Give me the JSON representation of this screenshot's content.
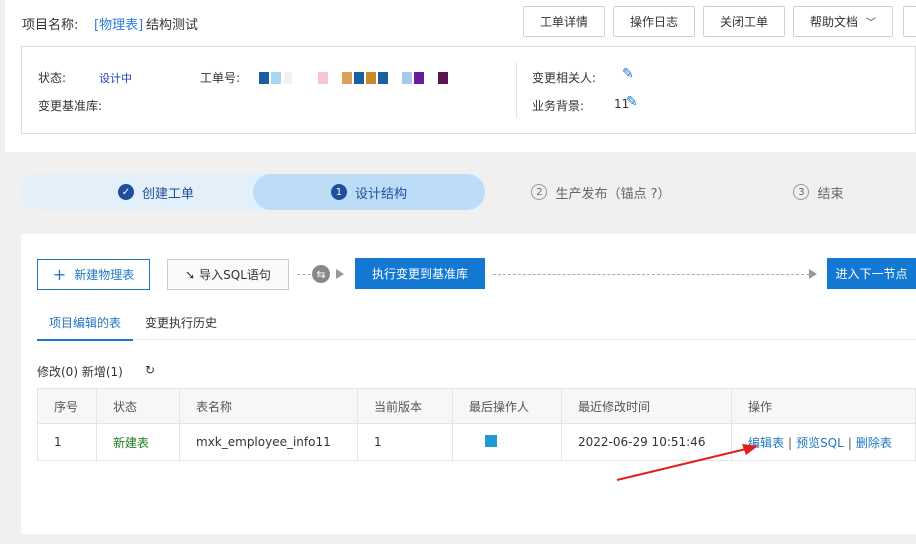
{
  "header": {
    "project_label": "项目名称:",
    "project_link": "[物理表]",
    "project_name": "结构测试",
    "buttons": [
      "工单详情",
      "操作日志",
      "关闭工单",
      "帮助文档"
    ]
  },
  "info": {
    "status_label": "状态:",
    "status_value": "设计中",
    "ticket_label": "工单号:",
    "base_label": "变更基准库:",
    "people_label": "变更相关人:",
    "background_label": "业务背景:",
    "background_value": "11"
  },
  "steps": [
    {
      "label": "创建工单",
      "marker": "✓"
    },
    {
      "label": "设计结构",
      "marker": "1"
    },
    {
      "label": "生产发布（锚点 ?）",
      "marker": "2"
    },
    {
      "label": "结束",
      "marker": "3"
    }
  ],
  "toolbar": {
    "new_table": "新建物理表",
    "import_sql": "导入SQL语句",
    "execute": "执行变更到基准库",
    "next_node": "进入下一节点"
  },
  "tabs": [
    "项目编辑的表",
    "变更执行历史"
  ],
  "stats": {
    "text": "修改(0)  新增(1)"
  },
  "table": {
    "headers": [
      "序号",
      "状态",
      "表名称",
      "当前版本",
      "最后操作人",
      "最近修改时间",
      "操作"
    ],
    "rows": [
      {
        "index": "1",
        "status": "新建表",
        "name": "mxk_employee_info11",
        "version": "1",
        "operator": "",
        "time": "2022-06-29 10:51:46",
        "ops": [
          "编辑表",
          "预览SQL",
          "删除表"
        ]
      }
    ]
  },
  "colors": {
    "accent": "#1378d2",
    "step_active": "#bcdcf7",
    "annotation": "#e02020"
  }
}
